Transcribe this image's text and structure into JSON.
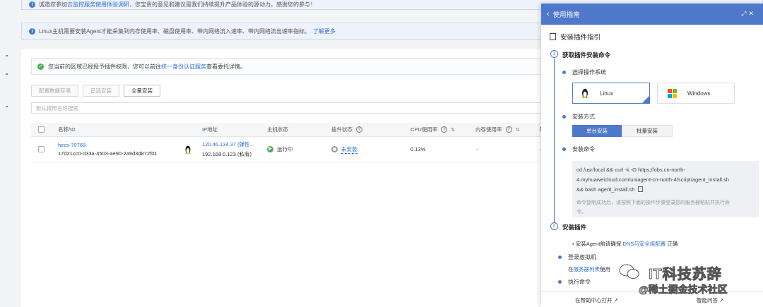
{
  "banner1": {
    "text_pre": "诚邀您参加",
    "link": "云监控服务使用体验调研",
    "text_post": "，您宝贵的意见和建议是我们持续提升产品体验的源动力，感谢您的参与！"
  },
  "banner2": {
    "text": "Linux主机需要安装Agent才能采集到内存使用率、磁盘使用率、带内网络流入速率、带内网络流出速率指标。",
    "link": "了解更多"
  },
  "notice": {
    "text_pre": "您当前的区域已经授予插件权限，您可以前往",
    "link": "统一身份认证服务",
    "text_post": "查看委托详情。"
  },
  "toolbar": {
    "btn1": "配置数据存储",
    "btn2": "已选安装",
    "btn3": "全量安装"
  },
  "search": {
    "placeholder": "默认按照名称搜索"
  },
  "table": {
    "headers": {
      "name": "名称/ID",
      "ip": "IP地址",
      "status": "主机状态",
      "plugin": "插件状态",
      "cpu": "CPU使用率",
      "mem": "内存使用率",
      "disk": "磁"
    },
    "row": {
      "name": "hecs-70768",
      "id": "17d21cc0-d33a-4503-ae90-2a9d3d872f01",
      "ip1": "120.46.134.37 (弹性...",
      "ip2": "192.168.0.123 (私有)",
      "status": "运行中",
      "plugin": "未安装",
      "cpu": "0.13%",
      "mem": "--",
      "disk": "--"
    }
  },
  "panel": {
    "header": "使用指南",
    "title": "安装插件指引",
    "step1": {
      "no": "1",
      "title": "获取插件安装命令"
    },
    "choose_os": "选择操作系统",
    "os_linux": "Linux",
    "os_windows": "Windows",
    "install_mode": "安装方式",
    "tab_single": "单台安装",
    "tab_batch": "批量安装",
    "install_cmd": "安装命令",
    "cmd_line1": "cd /usr/local && curl -k -O https://obs.cn-north-",
    "cmd_line2": "4.myhuaweicloud.com/uniagent-cn-north-4/script/agent_install.sh",
    "cmd_line3": "&& bash agent_install.sh",
    "cmd_note1": "命令复制成功后，请按照下面的操作步骤登录您的服务器粘贴并执行命",
    "cmd_note2": "令。",
    "step2": {
      "no": "2",
      "title": "安装插件"
    },
    "dns_pre": "• 安装Agent前请确保",
    "dns_link": "DNS与安全组配置",
    "dns_post": "正确",
    "login_vm": "登录虚拟机",
    "login_pre": "在",
    "login_link": "服务器列表",
    "login_post": "使用",
    "exec_cmd": "执行命令",
    "footer_open": "在帮助中心打开",
    "footer_ask": "智能问答"
  },
  "watermark": {
    "line1": "IT科技苏辞",
    "line2": "@稀土掘金技术社区"
  },
  "colors": {
    "accent": "#4e78c9",
    "link": "#2a6dd6",
    "ok": "#4caf50"
  }
}
